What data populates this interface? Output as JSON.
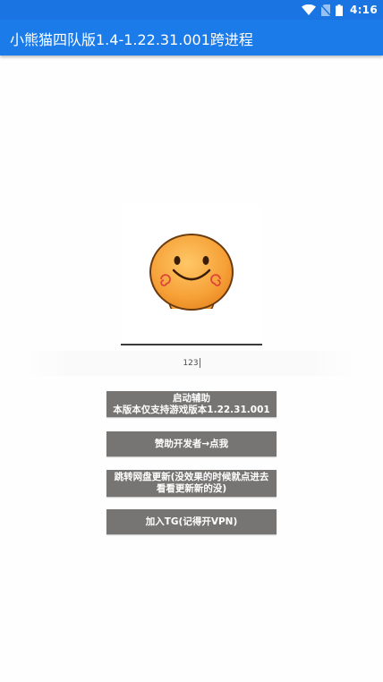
{
  "status_bar": {
    "time": "4:16",
    "icons": [
      "wifi-icon",
      "no-sim-icon",
      "battery-icon"
    ]
  },
  "app_bar": {
    "title": "小熊猫四队版1.4-1.22.31.001跨进程"
  },
  "avatar": {
    "icon": "smiley-face-icon"
  },
  "code_input": {
    "value": "123"
  },
  "buttons": {
    "start": {
      "line1": "启动辅助",
      "line2": "本版本仅支持游戏版本1.22.31.001"
    },
    "sponsor": {
      "label": "赞助开发者→点我"
    },
    "update": {
      "line1": "跳转网盘更新(没效果的时候就点进去",
      "line2": "看看更新新的没)"
    },
    "telegram": {
      "label": "加入TG(记得开VPN)"
    }
  },
  "colors": {
    "status_bar": "#1a75e3",
    "app_bar": "#1b7ce9",
    "button": "#777574",
    "face": "#f5a43c"
  }
}
